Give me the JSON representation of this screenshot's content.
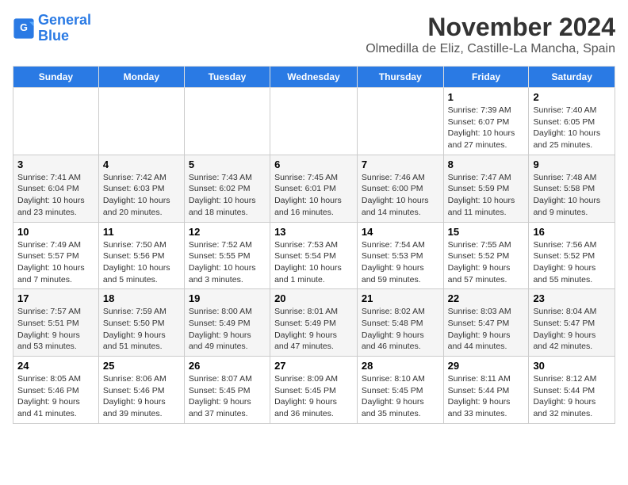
{
  "logo": {
    "line1": "General",
    "line2": "Blue"
  },
  "title": "November 2024",
  "subtitle": "Olmedilla de Eliz, Castille-La Mancha, Spain",
  "days_of_week": [
    "Sunday",
    "Monday",
    "Tuesday",
    "Wednesday",
    "Thursday",
    "Friday",
    "Saturday"
  ],
  "weeks": [
    [
      {
        "day": "",
        "info": ""
      },
      {
        "day": "",
        "info": ""
      },
      {
        "day": "",
        "info": ""
      },
      {
        "day": "",
        "info": ""
      },
      {
        "day": "",
        "info": ""
      },
      {
        "day": "1",
        "info": "Sunrise: 7:39 AM\nSunset: 6:07 PM\nDaylight: 10 hours and 27 minutes."
      },
      {
        "day": "2",
        "info": "Sunrise: 7:40 AM\nSunset: 6:05 PM\nDaylight: 10 hours and 25 minutes."
      }
    ],
    [
      {
        "day": "3",
        "info": "Sunrise: 7:41 AM\nSunset: 6:04 PM\nDaylight: 10 hours and 23 minutes."
      },
      {
        "day": "4",
        "info": "Sunrise: 7:42 AM\nSunset: 6:03 PM\nDaylight: 10 hours and 20 minutes."
      },
      {
        "day": "5",
        "info": "Sunrise: 7:43 AM\nSunset: 6:02 PM\nDaylight: 10 hours and 18 minutes."
      },
      {
        "day": "6",
        "info": "Sunrise: 7:45 AM\nSunset: 6:01 PM\nDaylight: 10 hours and 16 minutes."
      },
      {
        "day": "7",
        "info": "Sunrise: 7:46 AM\nSunset: 6:00 PM\nDaylight: 10 hours and 14 minutes."
      },
      {
        "day": "8",
        "info": "Sunrise: 7:47 AM\nSunset: 5:59 PM\nDaylight: 10 hours and 11 minutes."
      },
      {
        "day": "9",
        "info": "Sunrise: 7:48 AM\nSunset: 5:58 PM\nDaylight: 10 hours and 9 minutes."
      }
    ],
    [
      {
        "day": "10",
        "info": "Sunrise: 7:49 AM\nSunset: 5:57 PM\nDaylight: 10 hours and 7 minutes."
      },
      {
        "day": "11",
        "info": "Sunrise: 7:50 AM\nSunset: 5:56 PM\nDaylight: 10 hours and 5 minutes."
      },
      {
        "day": "12",
        "info": "Sunrise: 7:52 AM\nSunset: 5:55 PM\nDaylight: 10 hours and 3 minutes."
      },
      {
        "day": "13",
        "info": "Sunrise: 7:53 AM\nSunset: 5:54 PM\nDaylight: 10 hours and 1 minute."
      },
      {
        "day": "14",
        "info": "Sunrise: 7:54 AM\nSunset: 5:53 PM\nDaylight: 9 hours and 59 minutes."
      },
      {
        "day": "15",
        "info": "Sunrise: 7:55 AM\nSunset: 5:52 PM\nDaylight: 9 hours and 57 minutes."
      },
      {
        "day": "16",
        "info": "Sunrise: 7:56 AM\nSunset: 5:52 PM\nDaylight: 9 hours and 55 minutes."
      }
    ],
    [
      {
        "day": "17",
        "info": "Sunrise: 7:57 AM\nSunset: 5:51 PM\nDaylight: 9 hours and 53 minutes."
      },
      {
        "day": "18",
        "info": "Sunrise: 7:59 AM\nSunset: 5:50 PM\nDaylight: 9 hours and 51 minutes."
      },
      {
        "day": "19",
        "info": "Sunrise: 8:00 AM\nSunset: 5:49 PM\nDaylight: 9 hours and 49 minutes."
      },
      {
        "day": "20",
        "info": "Sunrise: 8:01 AM\nSunset: 5:49 PM\nDaylight: 9 hours and 47 minutes."
      },
      {
        "day": "21",
        "info": "Sunrise: 8:02 AM\nSunset: 5:48 PM\nDaylight: 9 hours and 46 minutes."
      },
      {
        "day": "22",
        "info": "Sunrise: 8:03 AM\nSunset: 5:47 PM\nDaylight: 9 hours and 44 minutes."
      },
      {
        "day": "23",
        "info": "Sunrise: 8:04 AM\nSunset: 5:47 PM\nDaylight: 9 hours and 42 minutes."
      }
    ],
    [
      {
        "day": "24",
        "info": "Sunrise: 8:05 AM\nSunset: 5:46 PM\nDaylight: 9 hours and 41 minutes."
      },
      {
        "day": "25",
        "info": "Sunrise: 8:06 AM\nSunset: 5:46 PM\nDaylight: 9 hours and 39 minutes."
      },
      {
        "day": "26",
        "info": "Sunrise: 8:07 AM\nSunset: 5:45 PM\nDaylight: 9 hours and 37 minutes."
      },
      {
        "day": "27",
        "info": "Sunrise: 8:09 AM\nSunset: 5:45 PM\nDaylight: 9 hours and 36 minutes."
      },
      {
        "day": "28",
        "info": "Sunrise: 8:10 AM\nSunset: 5:45 PM\nDaylight: 9 hours and 35 minutes."
      },
      {
        "day": "29",
        "info": "Sunrise: 8:11 AM\nSunset: 5:44 PM\nDaylight: 9 hours and 33 minutes."
      },
      {
        "day": "30",
        "info": "Sunrise: 8:12 AM\nSunset: 5:44 PM\nDaylight: 9 hours and 32 minutes."
      }
    ]
  ]
}
